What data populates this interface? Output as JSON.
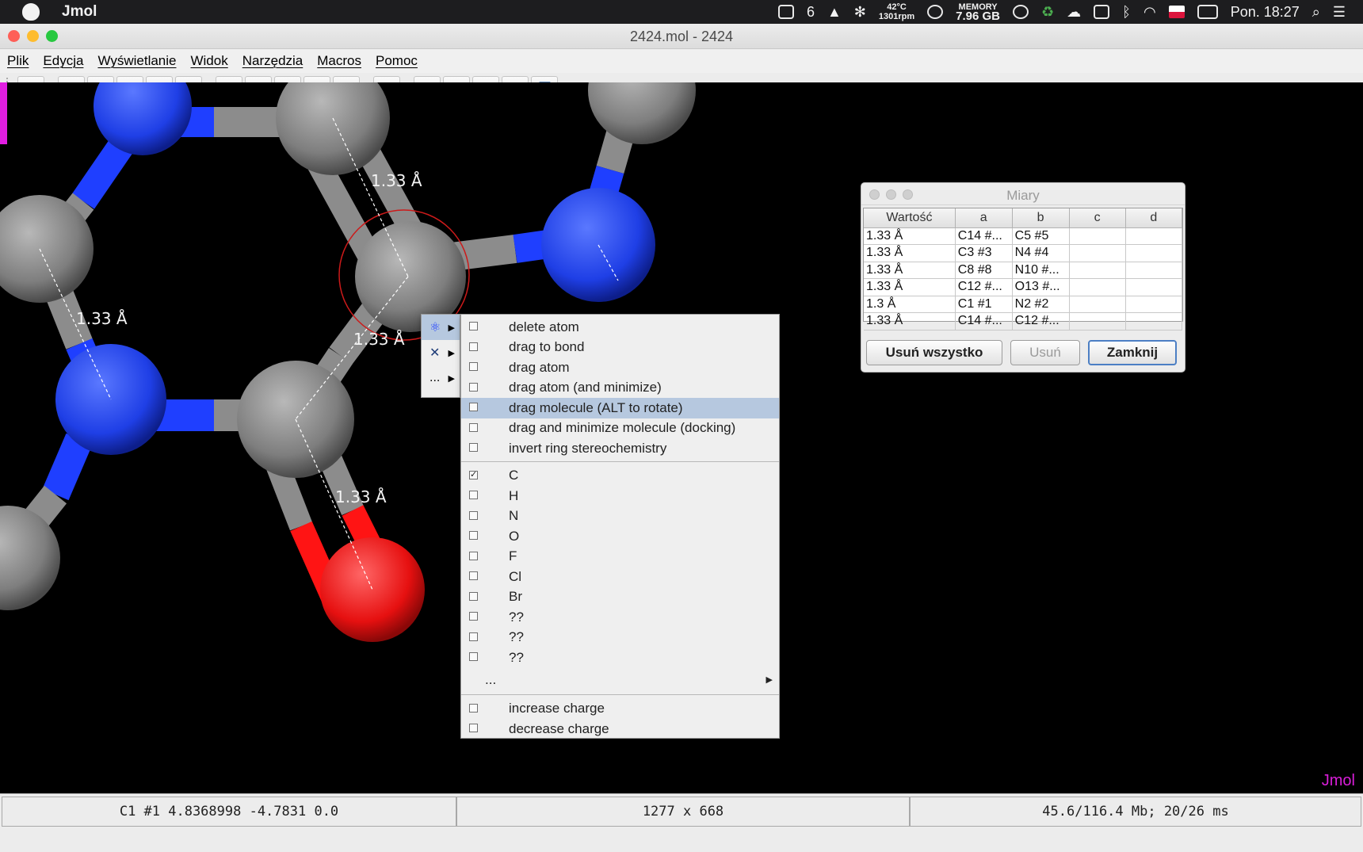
{
  "menubar": {
    "app_name": "Jmol",
    "tray": {
      "badge_count": "6",
      "temp": "42°C",
      "rpm": "1301rpm",
      "memory_label": "MEMORY",
      "memory_value": "7.96 GB",
      "clock": "Pon. 18:27"
    }
  },
  "window": {
    "title": "2424.mol - 2424",
    "menus": [
      "Plik",
      "Edycja",
      "Wyświetlanie",
      "Widok",
      "Narzędzia",
      "Macros",
      "Pomoc"
    ]
  },
  "toolbar": {
    "icons": [
      "open-icon",
      "screenshot-icon",
      "web-export-icon",
      "script-editor-icon",
      "console-icon",
      "print-icon",
      "rotate-icon",
      "select-icon",
      "measure-icon",
      "spin-icon",
      "model-kit-icon",
      "home-icon",
      "first-frame-icon",
      "prev-frame-icon",
      "next-frame-icon",
      "last-frame-icon",
      "copy-icon"
    ]
  },
  "viewer": {
    "measure_labels": [
      "1.33 Å",
      "1.33 Å",
      "1.33 Å",
      "1.33 Å"
    ],
    "logo": "Jmol",
    "colors": {
      "carbon": "#8c8c8c",
      "nitrogen": "#1f3fff",
      "oxygen": "#ff1414",
      "background": "#000000",
      "selection": "#cc1a1a"
    }
  },
  "popup": {
    "side_items": [
      {
        "label": "",
        "icon": "atom-mode-icon"
      },
      {
        "label": "",
        "icon": "bond-mode-icon"
      },
      {
        "label": "..."
      }
    ],
    "items_group1": [
      {
        "label": "delete atom",
        "checked": false
      },
      {
        "label": "drag to bond",
        "checked": false
      },
      {
        "label": "drag atom",
        "checked": false
      },
      {
        "label": "drag atom (and minimize)",
        "checked": false
      },
      {
        "label": "drag molecule (ALT to rotate)",
        "checked": false
      },
      {
        "label": "drag and minimize molecule (docking)",
        "checked": false
      },
      {
        "label": "invert ring stereochemistry",
        "checked": false
      }
    ],
    "items_group2": [
      {
        "label": "C",
        "checked": true
      },
      {
        "label": "H",
        "checked": false
      },
      {
        "label": "N",
        "checked": false
      },
      {
        "label": "O",
        "checked": false
      },
      {
        "label": "F",
        "checked": false
      },
      {
        "label": "Cl",
        "checked": false
      },
      {
        "label": "Br",
        "checked": false
      },
      {
        "label": "??",
        "checked": false
      },
      {
        "label": "??",
        "checked": false
      },
      {
        "label": "??",
        "checked": false
      }
    ],
    "more_label": "...",
    "items_group3": [
      {
        "label": "increase charge",
        "checked": false
      },
      {
        "label": "decrease charge",
        "checked": false
      }
    ],
    "selected_index": 4
  },
  "dialog": {
    "title": "Miary",
    "columns": [
      "Wartość",
      "a",
      "b",
      "c",
      "d"
    ],
    "rows": [
      [
        "1.33 Å",
        "C14 #...",
        "C5 #5",
        "",
        ""
      ],
      [
        "1.33 Å",
        "C3 #3",
        "N4 #4",
        "",
        ""
      ],
      [
        "1.33 Å",
        "C8 #8",
        "N10 #...",
        "",
        ""
      ],
      [
        "1.33 Å",
        "C12 #...",
        "O13 #...",
        "",
        ""
      ],
      [
        "1.3 Å",
        "C1 #1",
        "N2 #2",
        "",
        ""
      ],
      [
        "1.33 Å",
        "C14 #...",
        "C12 #...",
        "",
        ""
      ]
    ],
    "buttons": {
      "remove_all": "Usuń wszystko",
      "remove": "Usuń",
      "close": "Zamknij"
    }
  },
  "statusbar": {
    "atom_info": "C1 #1 4.8368998 -4.7831 0.0",
    "size": "1277 x 668",
    "memory": "45.6/116.4 Mb;  20/26 ms"
  }
}
